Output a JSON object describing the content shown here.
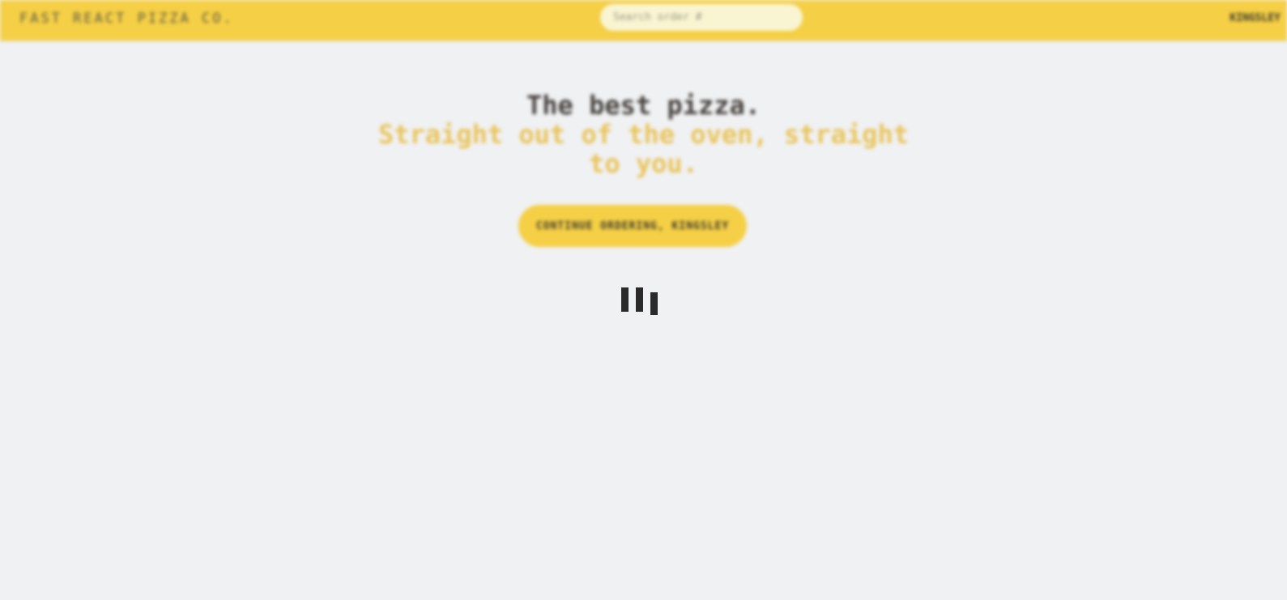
{
  "header": {
    "logo_text": "Fast React Pizza Co.",
    "search_placeholder": "Search order #",
    "username": "KINGSLEY"
  },
  "hero": {
    "title": "The best pizza.",
    "subtitle": "Straight out of the oven, straight to you."
  },
  "cta": {
    "label": "Continue ordering, KINGSLEY"
  },
  "loader": {
    "icon": "loading-bars-icon",
    "bar_count": 3
  },
  "colors": {
    "accent": "#f5cf45",
    "background": "#f0f1f3",
    "subtitle": "#e9c45a",
    "text": "#44403c"
  }
}
